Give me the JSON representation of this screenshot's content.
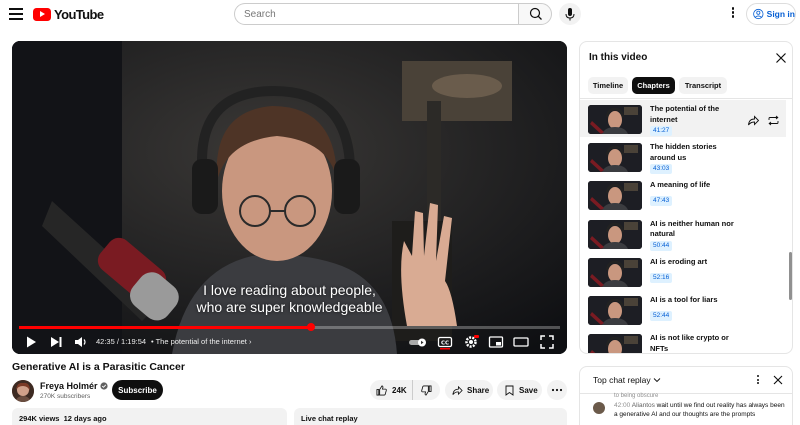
{
  "header": {
    "logo_text": "YouTube",
    "search_placeholder": "Search",
    "signin_label": "Sign in"
  },
  "player": {
    "caption_line1": "I love reading about people,",
    "caption_line2": "who are super knowledgeable",
    "time": "42:35 / 1:19:54",
    "chapter": "The potential of the internet",
    "progress": 0.54,
    "colors": {
      "progress": "#ff0000"
    }
  },
  "video": {
    "title": "Generative AI is a Parasitic Cancer",
    "channel": "Freya Holmér",
    "subscribers": "270K subscribers",
    "subscribe_label": "Subscribe",
    "likes": "24K",
    "share_label": "Share",
    "save_label": "Save",
    "views_line": "294K views  12 days ago",
    "live_chat_label": "Live chat replay"
  },
  "panel": {
    "title": "In this video",
    "tabs": [
      "Timeline",
      "Chapters",
      "Transcript"
    ],
    "active_tab": "Chapters",
    "chapters": [
      {
        "title": "The potential of the internet",
        "time": "41:27",
        "active": true
      },
      {
        "title": "The hidden stories around us",
        "time": "43:03"
      },
      {
        "title": "A meaning of life",
        "time": "47:43"
      },
      {
        "title": "AI is neither human nor natural",
        "time": "50:44"
      },
      {
        "title": "AI is eroding art",
        "time": "52:16"
      },
      {
        "title": "AI is a tool for liars",
        "time": "52:44"
      },
      {
        "title": "AI is not like crypto or NFTs",
        "time": ""
      }
    ]
  },
  "chat": {
    "title": "Top chat replay",
    "faded_text": "to being obscure",
    "message": {
      "time": "42:00",
      "author": "Aliantos",
      "text": "wait until we find out reality has always been a generative AI and our thoughts are the prompts"
    }
  }
}
